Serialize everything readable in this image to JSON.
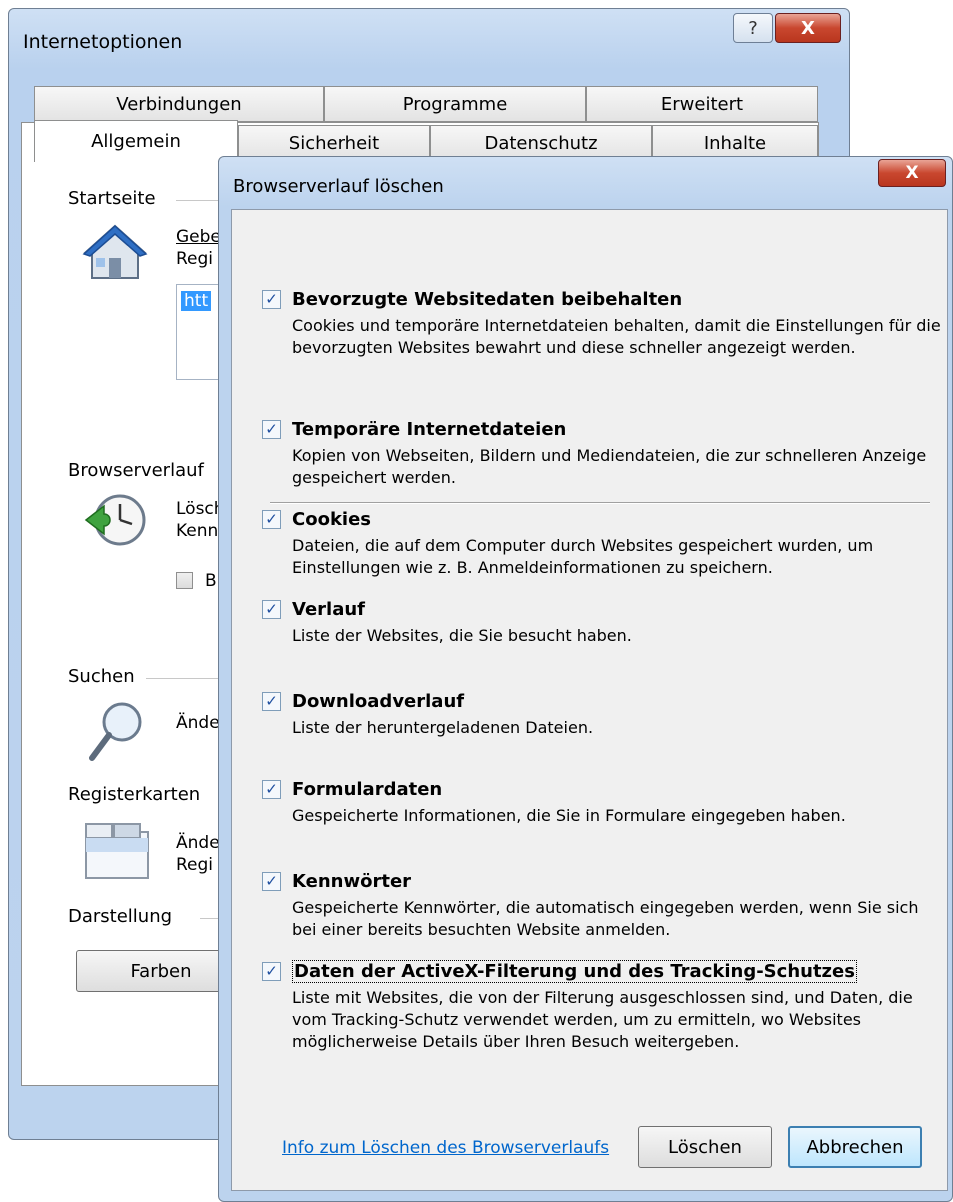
{
  "options_window": {
    "title": "Internetoptionen",
    "help_label": "?",
    "close_label": "X",
    "tabs_row1": [
      "Verbindungen",
      "Programme",
      "Erweitert"
    ],
    "tabs_row2": [
      "Allgemein",
      "Sicherheit",
      "Datenschutz",
      "Inhalte"
    ],
    "active_tab": "Allgemein",
    "startseite": {
      "label": "Startseite",
      "text_line1": "Gebe",
      "text_line2": "Regi",
      "url_value": "htt",
      "icon": "home-icon"
    },
    "browserverlauf": {
      "label": "Browserverlauf",
      "text_line1": "Lösch",
      "text_line2": "Kenn",
      "checkbox_label": "B",
      "icon": "history-clock-icon"
    },
    "suchen": {
      "label": "Suchen",
      "text_line1": "Ände",
      "icon": "magnifier-icon"
    },
    "registerkarten": {
      "label": "Registerkarten",
      "text_line1": "Ände",
      "text_line2": "Regi",
      "icon": "tabs-icon"
    },
    "darstellung": {
      "label": "Darstellung",
      "farben_button": "Farben"
    }
  },
  "delete_dialog": {
    "title": "Browserverlauf löschen",
    "close_label": "X",
    "check_glyph": "✓",
    "options": [
      {
        "title": "Bevorzugte Websitedaten beibehalten",
        "desc": "Cookies und temporäre Internetdateien behalten, damit die Einstellungen für die bevorzugten Websites bewahrt und diese schneller angezeigt werden.",
        "checked": true
      },
      {
        "title": "Temporäre Internetdateien",
        "desc": "Kopien von Webseiten, Bildern und Mediendateien, die zur schnelleren Anzeige gespeichert werden.",
        "checked": true
      },
      {
        "title": "Cookies",
        "desc": "Dateien, die auf dem Computer durch Websites gespeichert wurden, um Einstellungen wie z. B. Anmeldeinformationen zu speichern.",
        "checked": true
      },
      {
        "title": "Verlauf",
        "desc": "Liste der Websites, die Sie besucht haben.",
        "checked": true
      },
      {
        "title": "Downloadverlauf",
        "desc": "Liste der heruntergeladenen Dateien.",
        "checked": true
      },
      {
        "title": "Formulardaten",
        "desc": "Gespeicherte Informationen, die Sie in Formulare eingegeben haben.",
        "checked": true
      },
      {
        "title": "Kennwörter",
        "desc": "Gespeicherte Kennwörter, die automatisch eingegeben werden, wenn Sie sich bei einer bereits besuchten Website anmelden.",
        "checked": true
      },
      {
        "title": "Daten der ActiveX-Filterung und des Tracking-Schutzes",
        "desc": "Liste mit Websites, die von der Filterung ausgeschlossen sind, und Daten, die vom Tracking-Schutz verwendet werden, um zu ermitteln, wo Websites möglicherweise Details über Ihren Besuch weitergeben.",
        "checked": true
      }
    ],
    "info_link": "Info zum Löschen des Browserverlaufs",
    "delete_button": "Löschen",
    "cancel_button": "Abbrechen"
  }
}
